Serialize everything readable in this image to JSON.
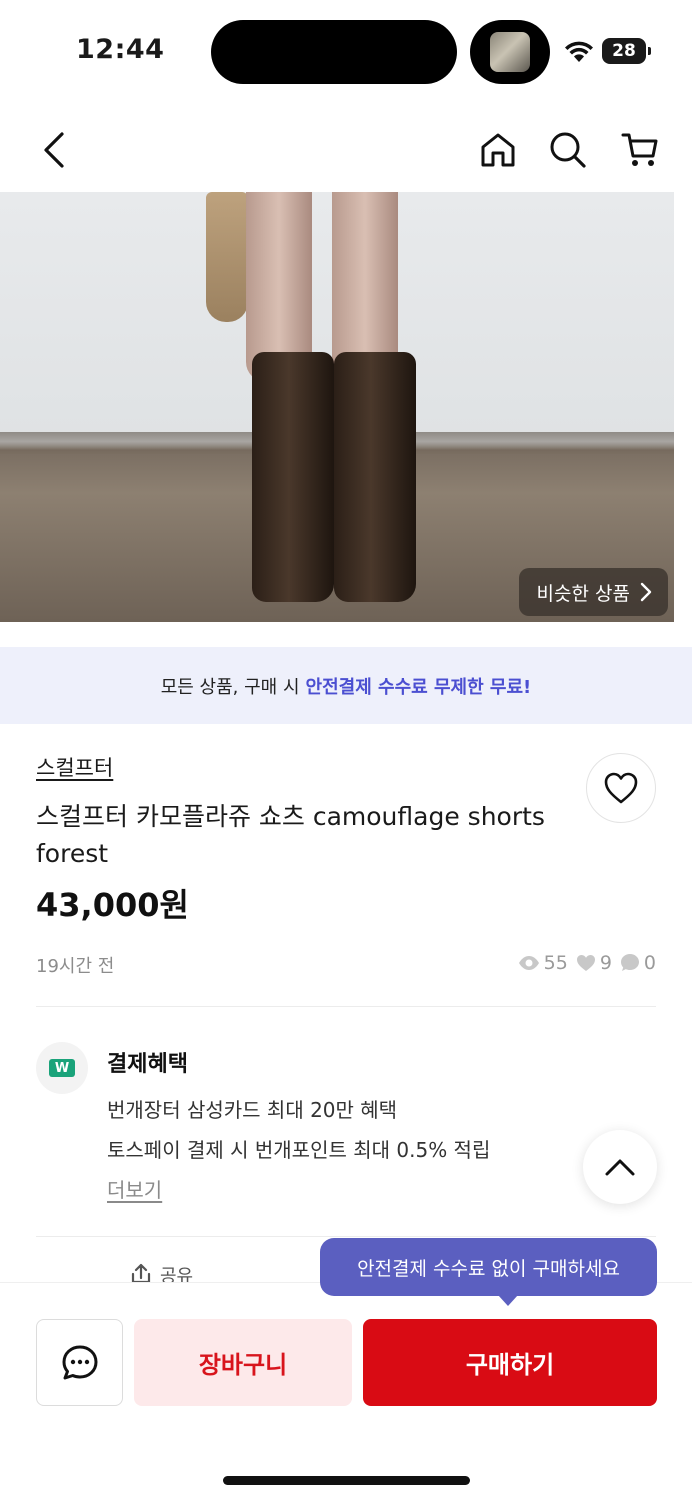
{
  "status_bar": {
    "time": "12:44",
    "battery": "28"
  },
  "nav": {
    "back_icon": "chevron-left-icon",
    "home_icon": "home-icon",
    "search_icon": "search-icon",
    "cart_icon": "cart-icon"
  },
  "product_image": {
    "similar_label": "비슷한 상품",
    "similar_icon": "chevron-right-icon"
  },
  "banner": {
    "text": "모든 상품, 구매 시",
    "highlight": "안전결제 수수료 무제한 무료!",
    "accent_color": "#4b4fd1"
  },
  "product": {
    "shop_name": "스컬프터",
    "title": "스컬프터 카모플라쥬 쇼츠 camouflage shorts forest",
    "price": "43,000원",
    "time_ago": "19시간 전",
    "views": "55",
    "likes": "9",
    "comments": "0"
  },
  "benefits": {
    "title": "결제혜택",
    "logo_mark": "W",
    "lines": [
      "번개장터 삼성카드 최대 20만 혜택",
      "토스페이 결제 시 번개포인트 최대 0.5% 적립"
    ],
    "more_label": "더보기"
  },
  "share": {
    "label": "공유"
  },
  "tooltip": {
    "text": "안전결제 수수료 없이 구매하세요"
  },
  "actions": {
    "cart_label": "장바구니",
    "buy_label": "구매하기",
    "brand_color": "#d90b14"
  }
}
